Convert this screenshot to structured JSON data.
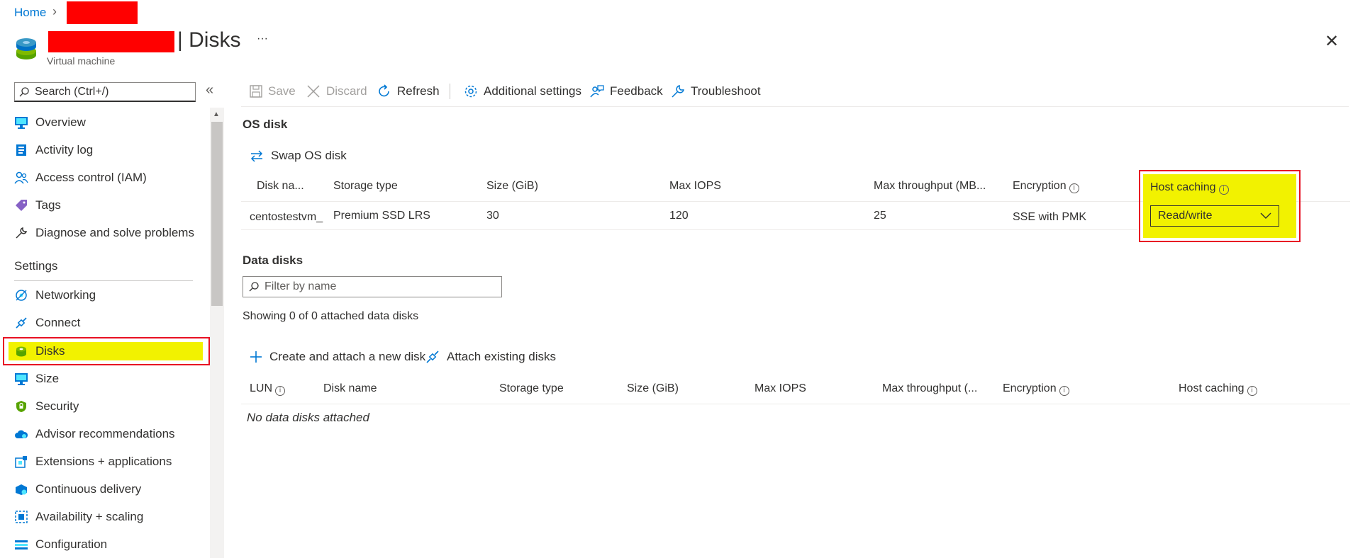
{
  "breadcrumb": {
    "home": "Home",
    "separator": "›"
  },
  "header": {
    "title_suffix": "| Disks",
    "more": "···",
    "subtitle": "Virtual machine",
    "close": "✕"
  },
  "sidebar": {
    "search_placeholder": "Search (Ctrl+/)",
    "collapse": "«",
    "items_top": [
      {
        "label": "Overview",
        "icon": "monitor-icon"
      },
      {
        "label": "Activity log",
        "icon": "log-icon"
      },
      {
        "label": "Access control (IAM)",
        "icon": "people-icon"
      },
      {
        "label": "Tags",
        "icon": "tag-icon"
      },
      {
        "label": "Diagnose and solve problems",
        "icon": "wrench-icon"
      }
    ],
    "section_settings": "Settings",
    "items_settings": [
      {
        "label": "Networking",
        "icon": "network-icon"
      },
      {
        "label": "Connect",
        "icon": "plug-icon"
      },
      {
        "label": "Disks",
        "icon": "disk-icon",
        "selected": true
      },
      {
        "label": "Size",
        "icon": "monitor-icon"
      },
      {
        "label": "Security",
        "icon": "shield-icon"
      },
      {
        "label": "Advisor recommendations",
        "icon": "cloud-icon"
      },
      {
        "label": "Extensions + applications",
        "icon": "extension-icon"
      },
      {
        "label": "Continuous delivery",
        "icon": "delivery-icon"
      },
      {
        "label": "Availability + scaling",
        "icon": "scaling-icon"
      },
      {
        "label": "Configuration",
        "icon": "config-icon"
      }
    ]
  },
  "toolbar": {
    "save": "Save",
    "discard": "Discard",
    "refresh": "Refresh",
    "additional_settings": "Additional settings",
    "feedback": "Feedback",
    "troubleshoot": "Troubleshoot"
  },
  "os_disk": {
    "heading": "OS disk",
    "swap": "Swap OS disk",
    "columns": [
      "Disk na...",
      "Storage type",
      "Size (GiB)",
      "Max IOPS",
      "Max throughput (MB...",
      "Encryption",
      "Host caching"
    ],
    "row": {
      "disk_name": "centostestvm_",
      "storage_type": "Premium SSD LRS",
      "size": "30",
      "max_iops": "120",
      "max_throughput": "25",
      "encryption": "SSE with PMK",
      "host_caching": "Read/write"
    }
  },
  "data_disks": {
    "heading": "Data disks",
    "filter_placeholder": "Filter by name",
    "showing": "Showing 0 of 0 attached data disks",
    "create_attach": "Create and attach a new disk",
    "attach_existing": "Attach existing disks",
    "columns": [
      "LUN",
      "Disk name",
      "Storage type",
      "Size (GiB)",
      "Max IOPS",
      "Max throughput (...",
      "Encryption",
      "Host caching"
    ],
    "empty": "No data disks attached"
  },
  "colors": {
    "accent": "#0078d4",
    "highlight": "#f2f200",
    "redact": "#ff0000",
    "border_red": "#e81123"
  }
}
